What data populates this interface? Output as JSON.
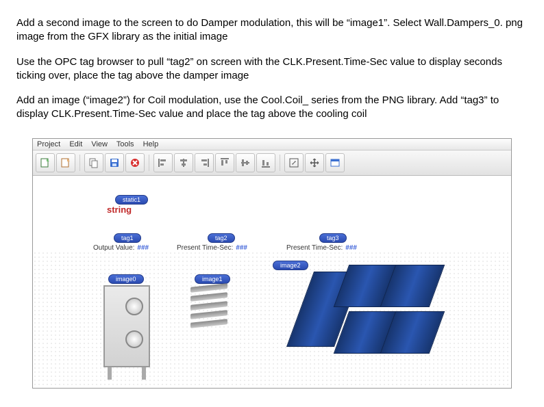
{
  "instructions": {
    "p1": "Add a second image to the screen to do Damper modulation, this will be “image1”.  Select Wall.Dampers_0. png image from the GFX library as the initial image",
    "p2": "Use the OPC tag browser to pull “tag2” on screen with the CLK.Present.Time-Sec value to display seconds ticking over, place the tag above the damper image",
    "p3": "Add an image (“image2”) for Coil modulation, use the Cool.Coil_ series from the PNG library. Add “tag3” to display CLK.Present.Time-Sec value and place the tag above the cooling coil"
  },
  "menu": {
    "m1": "Project",
    "m2": "Edit",
    "m3": "View",
    "m4": "Tools",
    "m5": "Help"
  },
  "toolbar_icons": {
    "i1": "new-project-icon",
    "i2": "open-icon",
    "i3": "save-icon",
    "i4": "copy-icon",
    "i5": "disk-icon",
    "i6": "delete-icon",
    "i7": "align-left-icon",
    "i8": "align-center-icon",
    "i9": "align-right-icon",
    "i10": "align-top-icon",
    "i11": "align-middle-icon",
    "i12": "align-bottom-icon",
    "i13": "resize-icon",
    "i14": "arrows-icon",
    "i15": "window-icon"
  },
  "canvas": {
    "static1_pill": "static1",
    "static1_text": "string",
    "tag1_pill": "tag1",
    "tag1_label": "Output Value:",
    "tag1_hash": "###",
    "tag2_pill": "tag2",
    "tag2_label": "Present Time-Sec:",
    "tag2_hash": "###",
    "tag3_pill": "tag3",
    "tag3_label": "Present Time-Sec:",
    "tag3_hash": "###",
    "image0_pill": "image0",
    "image1_pill": "image1",
    "image2_pill": "image2"
  }
}
